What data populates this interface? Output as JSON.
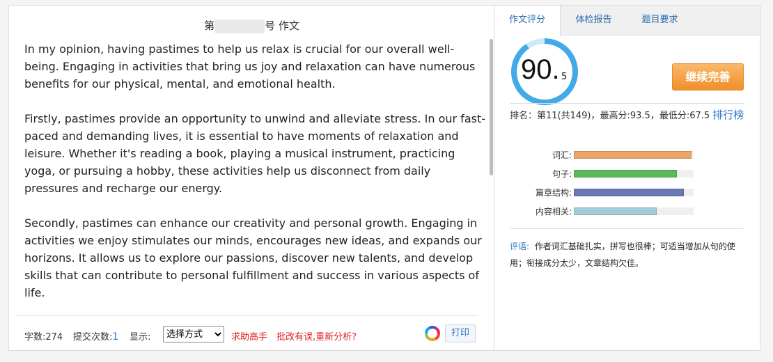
{
  "essay": {
    "title_prefix": "第",
    "title_suffix": "号 作文",
    "paragraphs": [
      "In my opinion, having pastimes to help us relax is crucial for our overall well-being. Engaging in activities that bring us joy and relaxation can have numerous benefits for our physical, mental, and emotional health.",
      "Firstly, pastimes provide an opportunity to unwind and alleviate stress. In our fast-paced and demanding lives, it is essential to have moments of relaxation and leisure. Whether it's reading a book, playing a musical instrument, practicing yoga, or pursuing a hobby, these activities help us disconnect from daily pressures and recharge our energy.",
      "Secondly, pastimes can enhance our creativity and personal growth. Engaging in activities we enjoy stimulates our minds, encourages new ideas, and expands our horizons. It allows us to explore our passions, discover new talents, and develop skills that can contribute to personal fulfillment and success in various aspects of life."
    ]
  },
  "toolbar": {
    "word_count_label": "字数:274",
    "submit_label": "提交次数:",
    "submit_count": "1",
    "display_label": "显示:",
    "display_selected": "选择方式",
    "help_link": "求助高手",
    "reanalyze_link": "批改有误,重新分析?",
    "print_label": "打印"
  },
  "tabs": [
    {
      "label": "作文评分",
      "active": true
    },
    {
      "label": "体检报告",
      "active": false
    },
    {
      "label": "题目要求",
      "active": false
    }
  ],
  "score": {
    "integer": "90.",
    "decimal": "5",
    "value": 90.5,
    "ring_color": "#43a9e8",
    "ring_track": "#cfe8f8"
  },
  "improve_button": "继续完善",
  "rank": {
    "text": "排名：第11(共149)，最高分:93.5，最低分:67.5",
    "link": "排行榜"
  },
  "bars": [
    {
      "label": "词汇:",
      "fraction": 0.98,
      "color": "#e8a767"
    },
    {
      "label": "句子:",
      "fraction": 0.86,
      "color": "#5cb85c"
    },
    {
      "label": "篇章结构:",
      "fraction": 0.92,
      "color": "#6a79b4"
    },
    {
      "label": "内容相关:",
      "fraction": 0.69,
      "color": "#a4cbdb"
    }
  ],
  "comment": {
    "label": "评语:",
    "text": "作者词汇基础扎实，拼写也很棒；可适当增加从句的使用；衔接成分太少，文章结构欠佳。"
  }
}
